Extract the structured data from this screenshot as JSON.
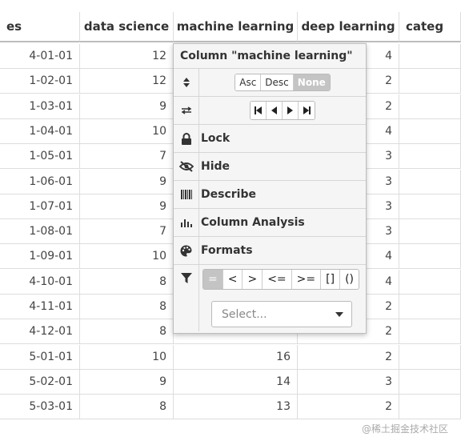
{
  "headers": [
    "es",
    "data science",
    "machine learning",
    "deep learning",
    "categ"
  ],
  "rows": [
    {
      "date": "4-01-01",
      "ds": "12",
      "ml": "",
      "dl": "4"
    },
    {
      "date": "1-02-01",
      "ds": "12",
      "ml": "",
      "dl": "2"
    },
    {
      "date": "1-03-01",
      "ds": "9",
      "ml": "",
      "dl": "2"
    },
    {
      "date": "1-04-01",
      "ds": "10",
      "ml": "",
      "dl": "4"
    },
    {
      "date": "1-05-01",
      "ds": "7",
      "ml": "",
      "dl": "3"
    },
    {
      "date": "1-06-01",
      "ds": "9",
      "ml": "",
      "dl": "3"
    },
    {
      "date": "1-07-01",
      "ds": "9",
      "ml": "",
      "dl": "3"
    },
    {
      "date": "1-08-01",
      "ds": "7",
      "ml": "",
      "dl": "3"
    },
    {
      "date": "1-09-01",
      "ds": "10",
      "ml": "",
      "dl": "4"
    },
    {
      "date": "4-10-01",
      "ds": "8",
      "ml": "",
      "dl": "4"
    },
    {
      "date": "4-11-01",
      "ds": "8",
      "ml": "",
      "dl": "2"
    },
    {
      "date": "4-12-01",
      "ds": "8",
      "ml": "",
      "dl": "2"
    },
    {
      "date": "5-01-01",
      "ds": "10",
      "ml": "16",
      "dl": "2"
    },
    {
      "date": "5-02-01",
      "ds": "9",
      "ml": "14",
      "dl": "3"
    },
    {
      "date": "5-03-01",
      "ds": "8",
      "ml": "13",
      "dl": "2"
    }
  ],
  "menu": {
    "title": "Column \"machine learning\"",
    "sort": [
      "Asc",
      "Desc",
      "None"
    ],
    "sort_active": "None",
    "items": [
      "Lock",
      "Hide",
      "Describe",
      "Column Analysis",
      "Formats"
    ],
    "filters": [
      "=",
      "<",
      ">",
      "<=",
      ">=",
      "[]",
      "()"
    ],
    "select_placeholder": "Select..."
  },
  "icons": {
    "sort": "sort-icon",
    "move": "move-arrows-icon",
    "lock": "lock-icon",
    "hide": "eye-slash-icon",
    "describe": "barcode-icon",
    "analysis": "bar-chart-icon",
    "formats": "palette-icon",
    "filter": "filter-icon"
  },
  "watermark": "@稀土掘金技术社区"
}
